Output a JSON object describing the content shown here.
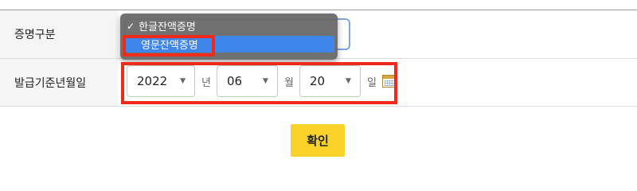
{
  "form": {
    "row1": {
      "label": "증명구분",
      "select": {
        "options": [
          {
            "label": "한글잔액증명",
            "checked": true
          },
          {
            "label": "영문잔액증명",
            "checked": false,
            "highlighted": true
          }
        ]
      }
    },
    "row2": {
      "label": "발급기준년월일",
      "year": {
        "value": "2022",
        "unit": "년"
      },
      "month": {
        "value": "06",
        "unit": "월"
      },
      "day": {
        "value": "20",
        "unit": "일"
      },
      "calendar_icon": "calendar-icon"
    }
  },
  "actions": {
    "confirm_label": "확인"
  },
  "colors": {
    "highlight_box": "#ee2a1a",
    "confirm_button": "#fbd22a",
    "selected_option": "#3f86ec",
    "dropdown_bg": "#696969"
  }
}
